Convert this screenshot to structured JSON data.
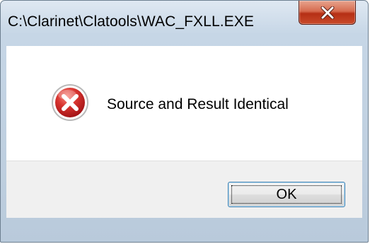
{
  "window": {
    "title": "C:\\Clarinet\\Clatools\\WAC_FXLL.EXE"
  },
  "titlebar": {
    "close_icon": "close-x-icon"
  },
  "dialog": {
    "icon": "error-icon",
    "message": "Source and Result Identical"
  },
  "buttons": {
    "ok_label": "OK"
  },
  "colors": {
    "close_button": "#c94a2a",
    "error_icon": "#c8262b",
    "frame": "#c6d6e6",
    "focus_border": "#3c7fb1"
  }
}
